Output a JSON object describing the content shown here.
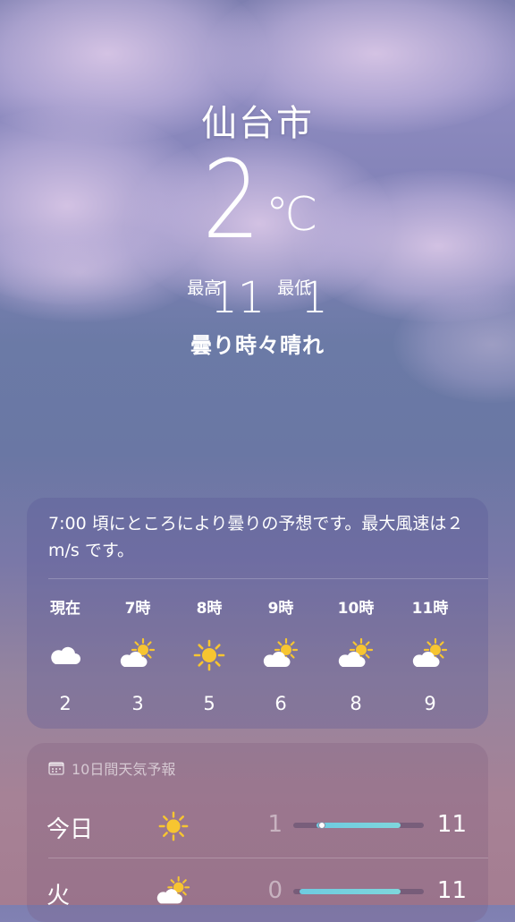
{
  "location": {
    "city": "仙台市",
    "temperature": "2",
    "unit": "℃",
    "high_label": "最高",
    "high": "11",
    "low_label": "最低",
    "low": "1",
    "condition": "曇り時々晴れ"
  },
  "hourly": {
    "summary": "7:00 頃にところにより曇りの予想です。最大風速は２m/s です。",
    "hours": [
      {
        "time": "現在",
        "icon": "cloud-icon",
        "temp": "2"
      },
      {
        "time": "7時",
        "icon": "partly-sunny-icon",
        "temp": "3"
      },
      {
        "time": "8時",
        "icon": "sun-icon",
        "temp": "5"
      },
      {
        "time": "9時",
        "icon": "partly-sunny-icon",
        "temp": "6"
      },
      {
        "time": "10時",
        "icon": "partly-sunny-icon",
        "temp": "8"
      },
      {
        "time": "11時",
        "icon": "partly-sunny-icon",
        "temp": "9"
      }
    ]
  },
  "daily": {
    "header": "10日間天気予報",
    "header_icon": "calendar-icon",
    "days": [
      {
        "day": "今日",
        "icon": "sun-icon",
        "low": "1",
        "high": "11",
        "range_start": 0.18,
        "range_end": 0.82,
        "current": 0.18
      },
      {
        "day": "火",
        "icon": "partly-sunny-icon",
        "low": "0",
        "high": "11",
        "range_start": 0.05,
        "range_end": 0.82
      }
    ]
  },
  "colors": {
    "sun": "#f7c531",
    "bar_fill": "#6ecbe0"
  }
}
